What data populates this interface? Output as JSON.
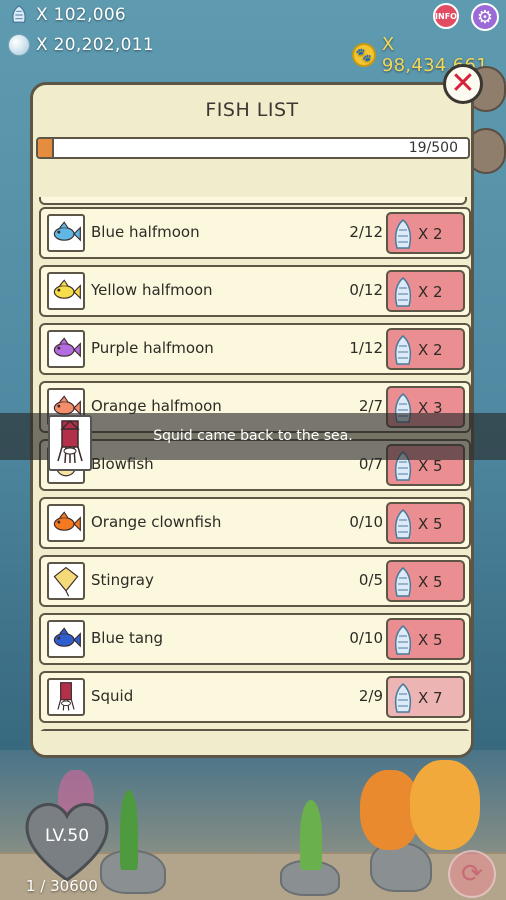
{
  "hud": {
    "shells": "X 102,006",
    "pearls": "X 20,202,011",
    "paw_coins": "X 98,434,661",
    "info_label": "INFO"
  },
  "icons": {
    "shell": "shell-icon",
    "pearl": "pearl-icon",
    "paw": "paw-icon",
    "gear": "gear-icon",
    "close": "close-icon",
    "refresh": "refresh-icon"
  },
  "colors": {
    "panel_bg": "#f1eccb",
    "multiplier_bg": "#eb8e92",
    "progress_fill": "#e58d3f",
    "close_x": "#d8203a"
  },
  "fish_list": {
    "title": "FISH LIST",
    "progress_text": "19/500",
    "progress_fraction": 0.038,
    "items": [
      {
        "name": "Blue halfmoon",
        "count": "2/12",
        "multiplier": "X 2",
        "color": "#5fb7e5"
      },
      {
        "name": "Yellow halfmoon",
        "count": "0/12",
        "multiplier": "X 2",
        "color": "#f6de4a"
      },
      {
        "name": "Purple halfmoon",
        "count": "1/12",
        "multiplier": "X 2",
        "color": "#b36be0"
      },
      {
        "name": "Orange halfmoon",
        "count": "2/7",
        "multiplier": "X 3",
        "color": "#f58d6b"
      },
      {
        "name": "Blowfish",
        "count": "0/7",
        "multiplier": "X 5",
        "color": "#f4e6a0"
      },
      {
        "name": "Orange clownfish",
        "count": "0/10",
        "multiplier": "X 5",
        "color": "#f47a22"
      },
      {
        "name": "Stingray",
        "count": "0/5",
        "multiplier": "X 5",
        "color": "#f5da7a"
      },
      {
        "name": "Blue tang",
        "count": "0/10",
        "multiplier": "X 5",
        "color": "#2f5fcf"
      },
      {
        "name": "Squid",
        "count": "2/9",
        "multiplier": "X 7",
        "color": "#b3304a"
      }
    ]
  },
  "toast": {
    "message": "Squid came back to the sea."
  },
  "player": {
    "level": "LV.50",
    "xp": "1 / 30600"
  }
}
